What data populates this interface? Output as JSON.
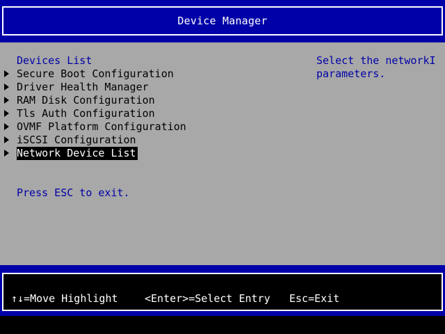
{
  "header": {
    "title": "Device Manager"
  },
  "main": {
    "section_title": "Devices List",
    "menu_items": [
      {
        "label": "Secure Boot Configuration"
      },
      {
        "label": "Driver Health Manager"
      },
      {
        "label": "RAM Disk Configuration"
      },
      {
        "label": "Tls Auth Configuration"
      },
      {
        "label": "OVMF Platform Configuration"
      },
      {
        "label": "iSCSI Configuration"
      },
      {
        "label": "Network Device List",
        "selected": true
      }
    ],
    "exit_text": "Press ESC to exit.",
    "help_lines": [
      "Select the networkI",
      "parameters."
    ]
  },
  "footer": {
    "move_hint": "↑↓=Move Highlight",
    "enter_hint": "<Enter>=Select Entry",
    "esc_hint": "Esc=Exit"
  },
  "colors": {
    "header_bg": "#0000a8",
    "body_bg": "#a8a8a8",
    "accent_text": "#0000a8",
    "selected_bg": "#000000",
    "selected_text": "#ffffff"
  }
}
